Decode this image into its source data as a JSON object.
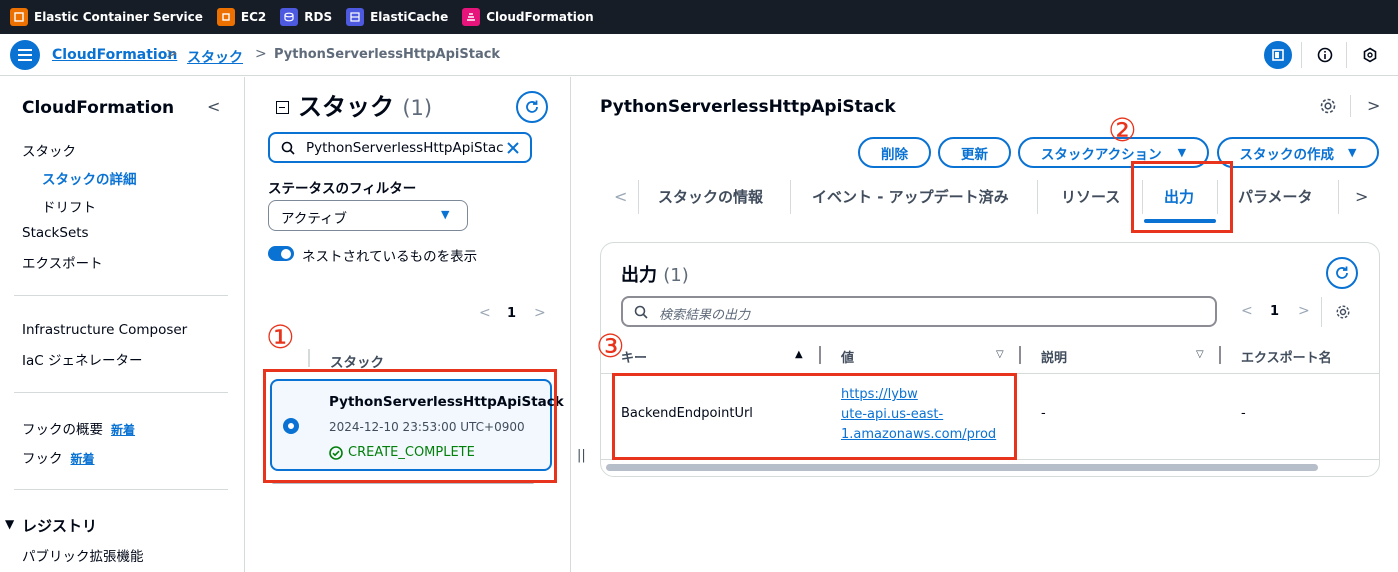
{
  "topbar": {
    "services": [
      {
        "label": "Elastic Container Service",
        "color": "#ed7100",
        "icon": "ecs-icon"
      },
      {
        "label": "EC2",
        "color": "#ed7100",
        "icon": "ec2-icon"
      },
      {
        "label": "RDS",
        "color": "#4d5ae0",
        "icon": "rds-icon"
      },
      {
        "label": "ElastiCache",
        "color": "#4d5ae0",
        "icon": "elasticache-icon"
      },
      {
        "label": "CloudFormation",
        "color": "#e7157b",
        "icon": "cloudformation-icon"
      }
    ]
  },
  "breadcrumb": {
    "item1": "CloudFormation",
    "item2": "スタック",
    "current": "PythonServerlessHttpApiStack"
  },
  "leftnav": {
    "title": "CloudFormation",
    "stacks": "スタック",
    "stack_details": "スタックの詳細",
    "drift": "ドリフト",
    "stacksets": "StackSets",
    "exports": "エクスポート",
    "infra_composer": "Infrastructure Composer",
    "iac_generator": "IaC ジェネレーター",
    "hooks_overview": "フックの概要",
    "hooks": "フック",
    "new_badge": "新着",
    "registry": "レジストリ",
    "public_extensions": "パブリック拡張機能"
  },
  "stacks_panel": {
    "title": "スタック",
    "count": "(1)",
    "search_value": "PythonServerlessHttpApiStac",
    "filter_label": "ステータスのフィルター",
    "filter_value": "アクティブ",
    "toggle_label": "ネストされているものを表示",
    "page": "1",
    "column_header": "スタック",
    "stack": {
      "name": "PythonServerlessHttpApiStack",
      "date": "2024-12-10 23:53:00 UTC+0900",
      "status": "CREATE_COMPLETE"
    }
  },
  "detail": {
    "title": "PythonServerlessHttpApiStack",
    "buttons": {
      "delete": "削除",
      "update": "更新",
      "stack_actions": "スタックアクション",
      "create_stack": "スタックの作成"
    },
    "tabs": [
      "スタックの情報",
      "イベント - アップデート済み",
      "リソース",
      "出力",
      "パラメータ"
    ],
    "outputs": {
      "title": "出力",
      "count": "(1)",
      "search_placeholder": "検索結果の出力",
      "page": "1",
      "columns": [
        "キー",
        "値",
        "説明",
        "エクスポート名"
      ],
      "rows": [
        {
          "key": "BackendEndpointUrl",
          "value_line1": "https://lybw",
          "value_line2": "ute-api.us-east-",
          "value_line3": "1.amazonaws.com/prod",
          "description": "-",
          "export_name": "-"
        }
      ]
    }
  },
  "annotations": [
    "①",
    "②",
    "③"
  ],
  "colors": {
    "accent": "#0972d3",
    "annotation_red": "#e8341c",
    "success": "#037f0c",
    "topbar": "#161d26"
  }
}
